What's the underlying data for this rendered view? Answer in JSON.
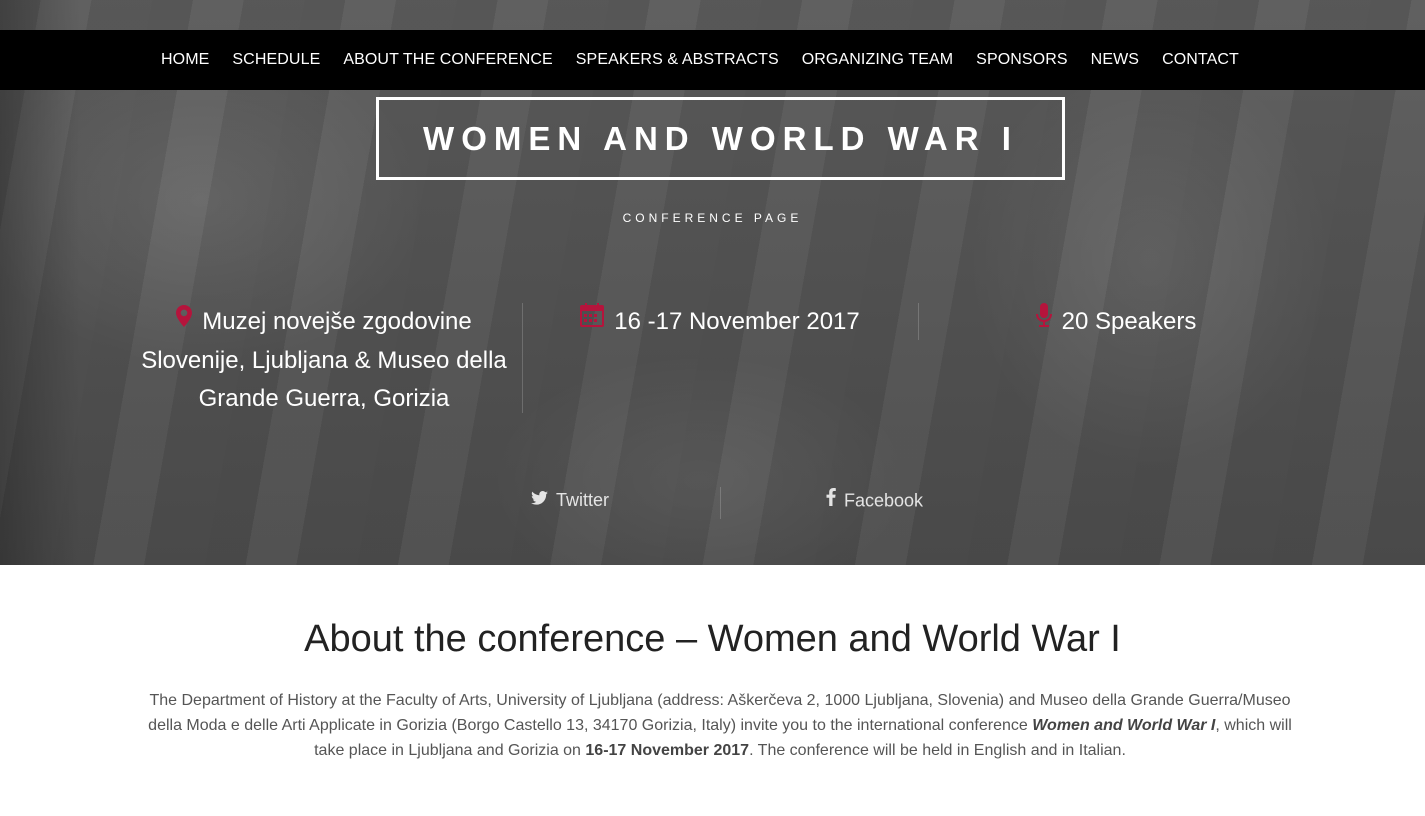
{
  "nav": {
    "items": [
      "HOME",
      "SCHEDULE",
      "ABOUT THE CONFERENCE",
      "SPEAKERS & ABSTRACTS",
      "ORGANIZING TEAM",
      "SPONSORS",
      "NEWS",
      "CONTACT"
    ]
  },
  "hero": {
    "title": "WOMEN AND WORLD WAR I",
    "subtitle": "CONFERENCE PAGE",
    "location": "Muzej novejše zgodovine Slovenije, Ljubljana & Museo della Grande Guerra, Gorizia",
    "dates": "16 -17 November 2017",
    "speakers": "20 Speakers",
    "twitter": "Twitter",
    "facebook": "Facebook"
  },
  "about": {
    "title": "About the conference – Women and World War I",
    "text_part1": "The Department of History at the Faculty of Arts, University of Ljubljana (address: Aškerčeva 2, 1000 Ljubljana, Slovenia) and Museo della Grande Guerra/Museo della Moda e delle Arti Applicate in Gorizia (Borgo Castello 13, 34170 Gorizia, Italy) invite you to the international conference ",
    "text_emph": "Women and World War I",
    "text_part2": ", which will take place in Ljubljana and Gorizia on ",
    "text_bold": "16-17 November 2017",
    "text_part3": ". The conference will be held in English and in Italian."
  },
  "colors": {
    "accent": "#b5143c",
    "navbar": "#000000"
  },
  "icons": {
    "location": "map-marker-icon",
    "dates": "calendar-icon",
    "speakers": "microphone-icon",
    "twitter": "twitter-icon",
    "facebook": "facebook-icon"
  }
}
